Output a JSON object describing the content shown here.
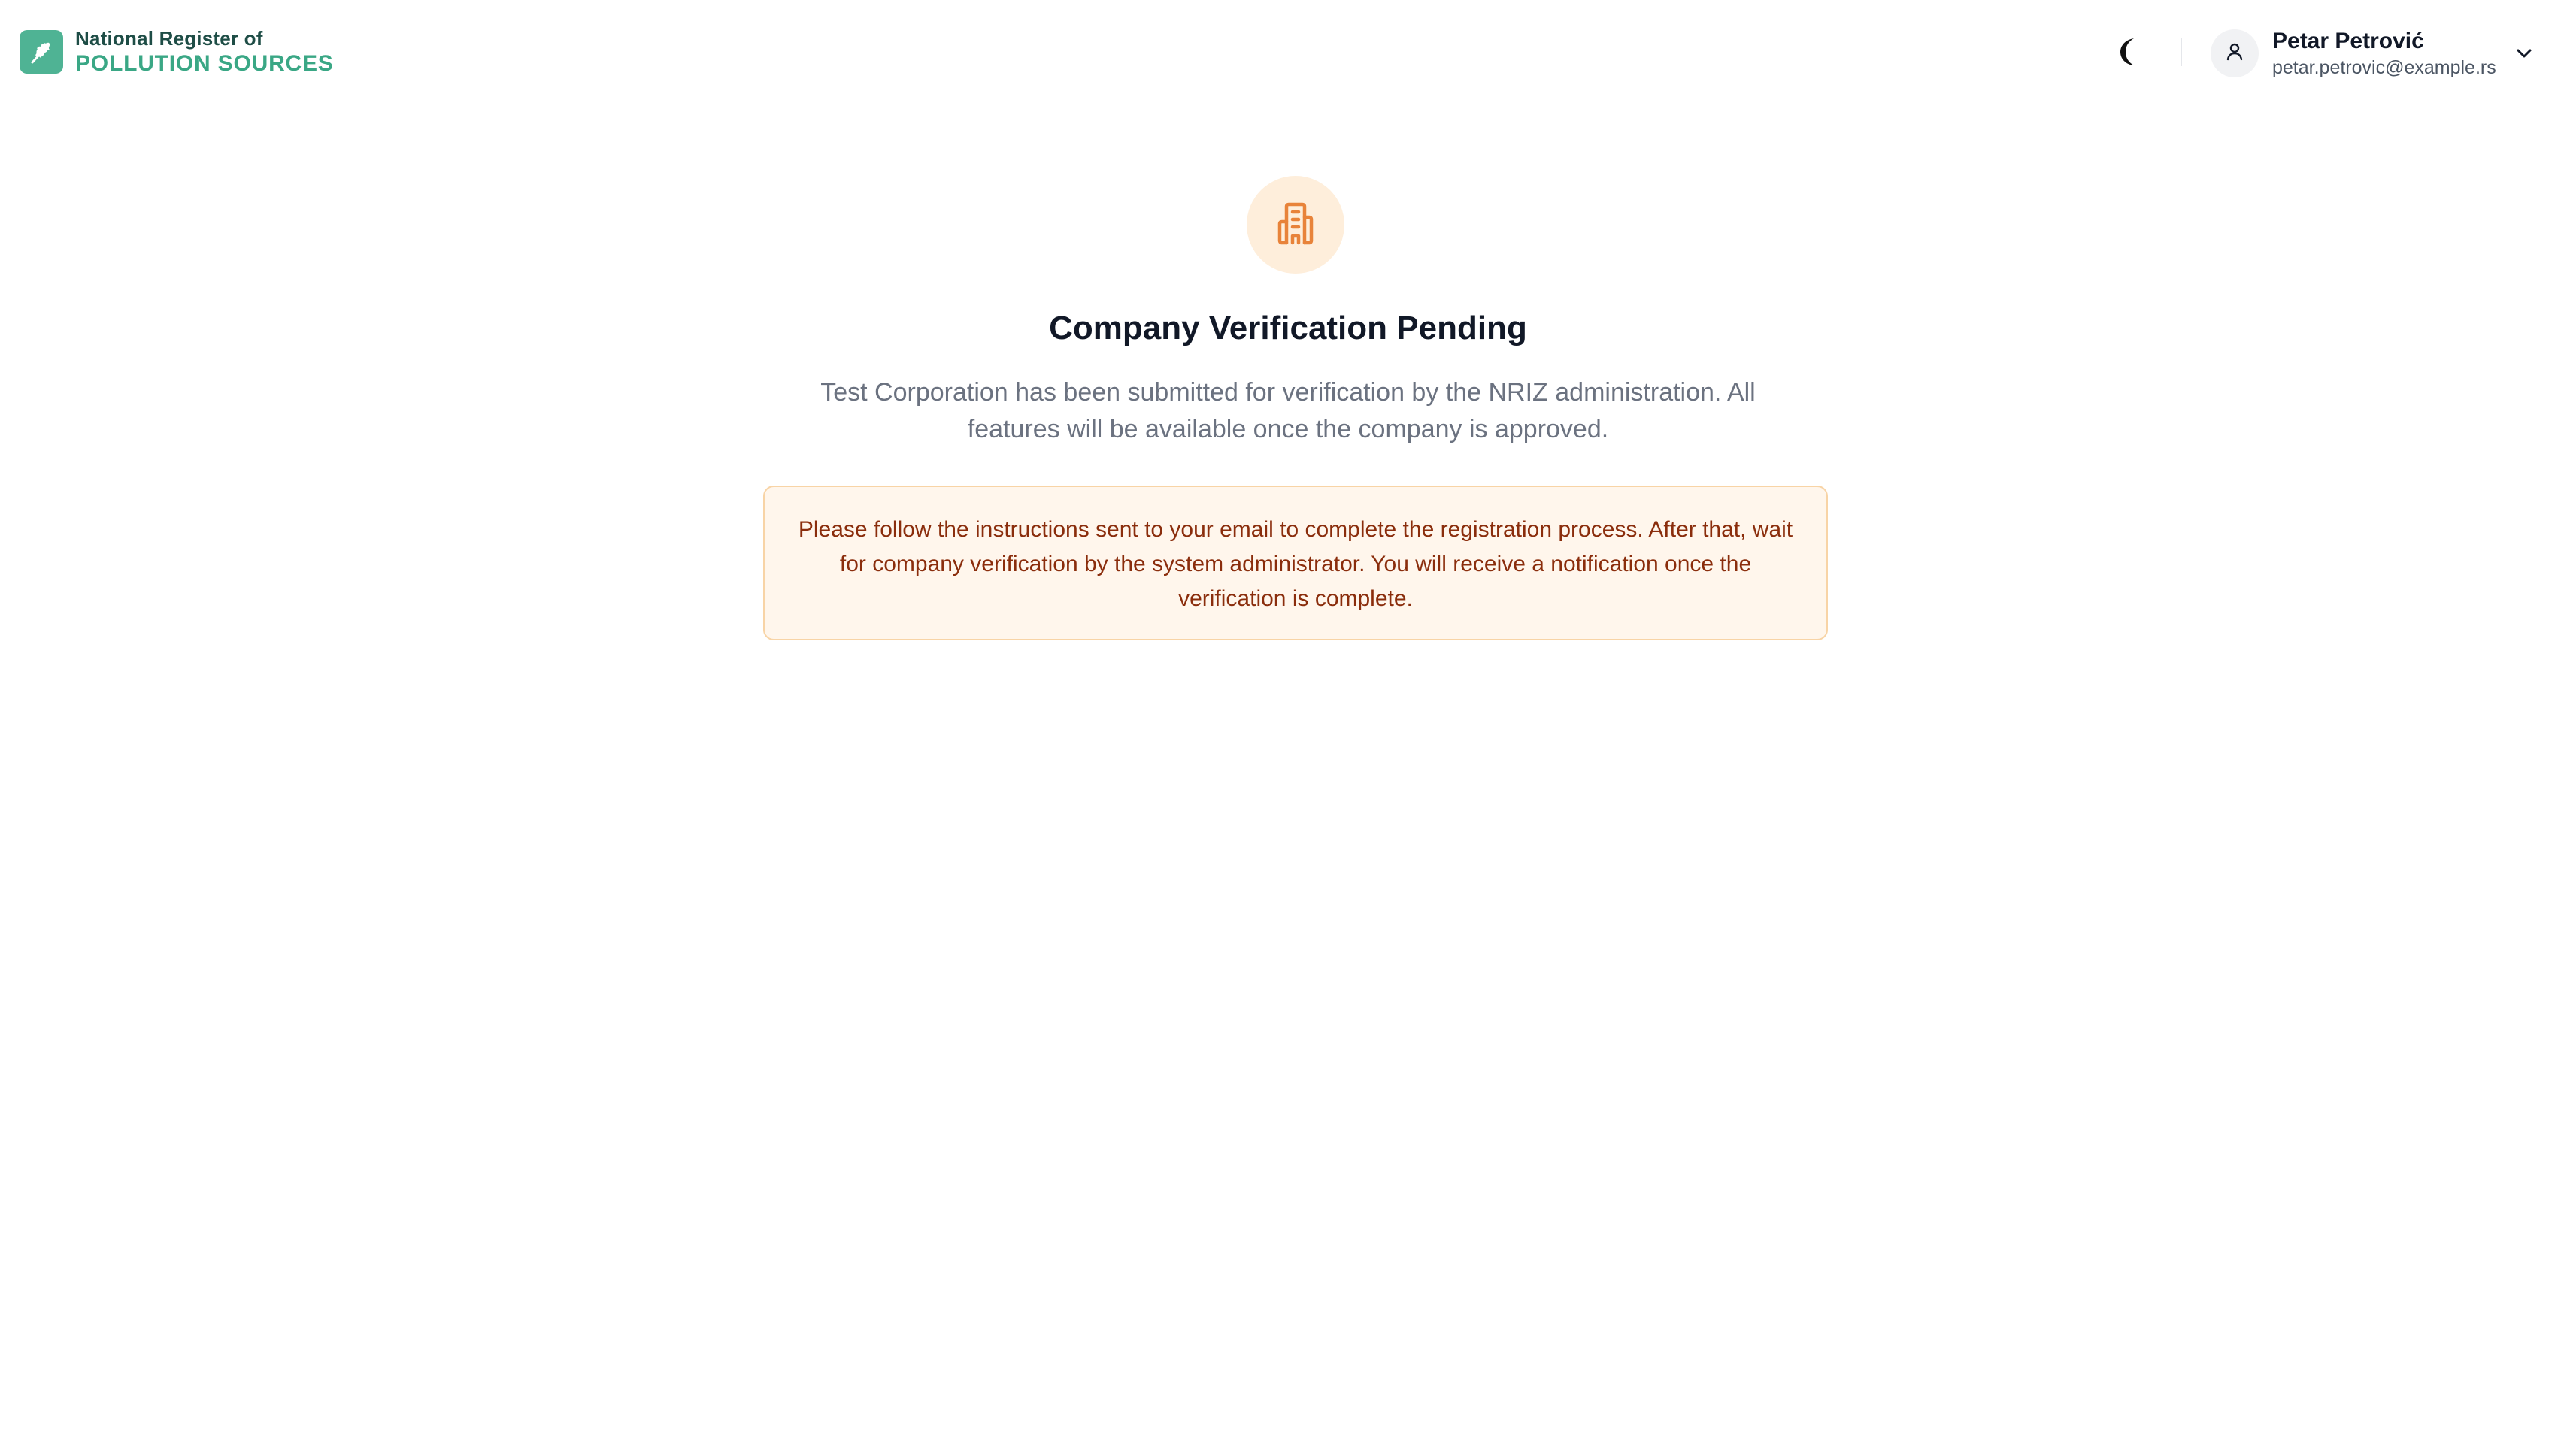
{
  "brand": {
    "line1": "National Register of",
    "line2": "POLLUTION SOURCES",
    "logo_icon": "oak-leaf-icon",
    "logo_color": "#4fb394"
  },
  "header": {
    "theme_toggle_icon": "moon-icon",
    "user": {
      "name": "Petar Petrović",
      "email": "petar.petrovic@example.rs",
      "avatar_icon": "user-icon",
      "menu_icon": "chevron-down-icon"
    }
  },
  "main": {
    "status_icon": "building-icon",
    "status_color": "#e8833a",
    "title": "Company Verification Pending",
    "description": "Test Corporation has been submitted for verification by the NRIZ administration. All features will be available once the company is approved.",
    "notice": "Please follow the instructions sent to your email to complete the registration process. After that, wait for company verification by the system administrator. You will receive a notification once the verification is complete."
  }
}
